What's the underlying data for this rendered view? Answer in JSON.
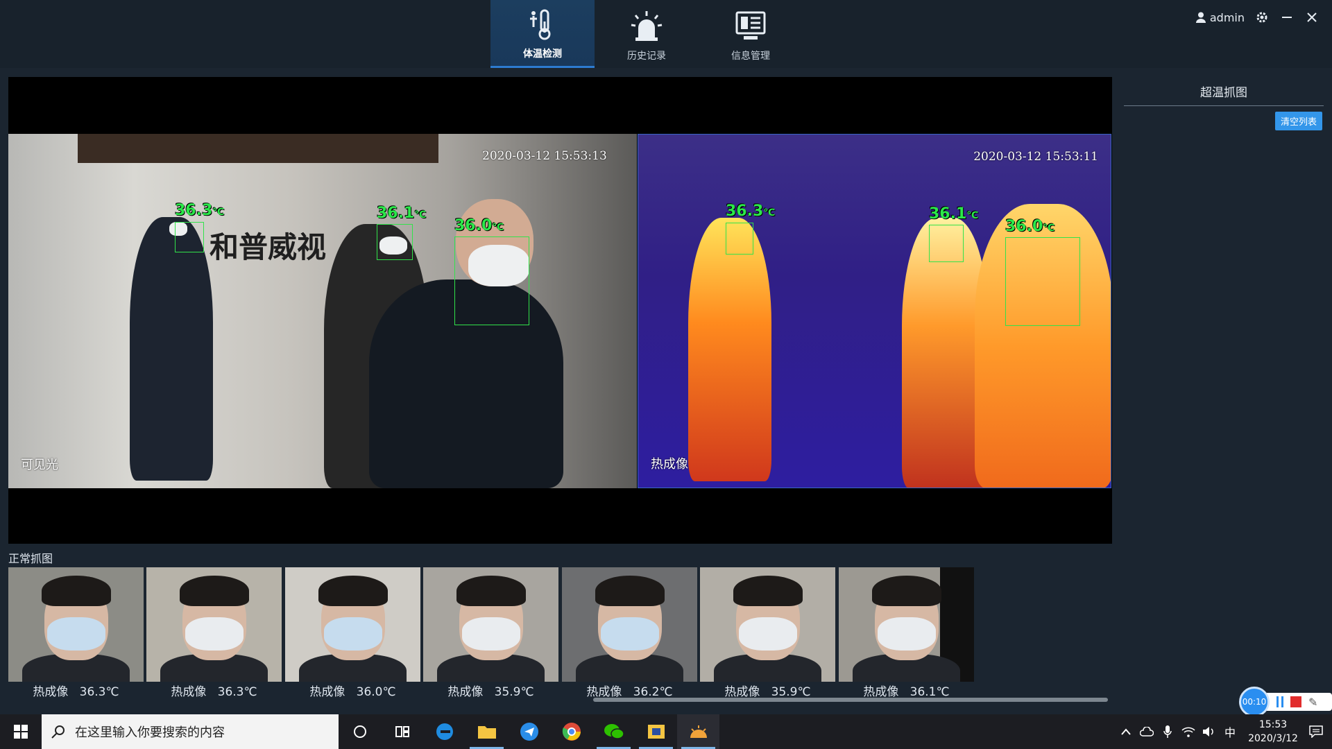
{
  "nav": {
    "items": [
      {
        "label": "体温检测",
        "icon": "thermometer-icon",
        "active": true
      },
      {
        "label": "历史记录",
        "icon": "alarm-light-icon",
        "active": false
      },
      {
        "label": "信息管理",
        "icon": "monitor-info-icon",
        "active": false
      }
    ]
  },
  "header": {
    "user": "admin"
  },
  "video": {
    "visible": {
      "timestamp": "2020-03-12 15:53:13",
      "tag": "可见光",
      "sign": "和普威视",
      "detections": [
        {
          "temp": "36.3",
          "unit": "℃"
        },
        {
          "temp": "36.1",
          "unit": "℃"
        },
        {
          "temp": "36.0",
          "unit": "℃"
        }
      ]
    },
    "thermal": {
      "timestamp": "2020-03-12  15:53:11",
      "tag": "热成像",
      "detections": [
        {
          "temp": "36.3",
          "unit": "℃"
        },
        {
          "temp": "36.1",
          "unit": "℃"
        },
        {
          "temp": "36.0",
          "unit": "℃"
        }
      ]
    }
  },
  "right_panel": {
    "title": "超温抓图",
    "clear_label": "清空列表"
  },
  "strip": {
    "label": "正常抓图",
    "snapshots": [
      {
        "caption": "热成像   36.3℃"
      },
      {
        "caption": "热成像   36.3℃"
      },
      {
        "caption": "热成像   36.0℃"
      },
      {
        "caption": "热成像   35.9℃"
      },
      {
        "caption": "热成像   36.2℃"
      },
      {
        "caption": "热成像   35.9℃"
      },
      {
        "caption": "热成像   36.1℃"
      }
    ]
  },
  "recorder": {
    "elapsed": "00:10"
  },
  "taskbar": {
    "search_placeholder": "在这里输入你要搜索的内容",
    "ime": "中",
    "time": "15:53",
    "date": "2020/3/12"
  },
  "colors": {
    "accent": "#3396ea",
    "detect_green": "#2be84a",
    "nav_active": "#1c3e5f"
  }
}
